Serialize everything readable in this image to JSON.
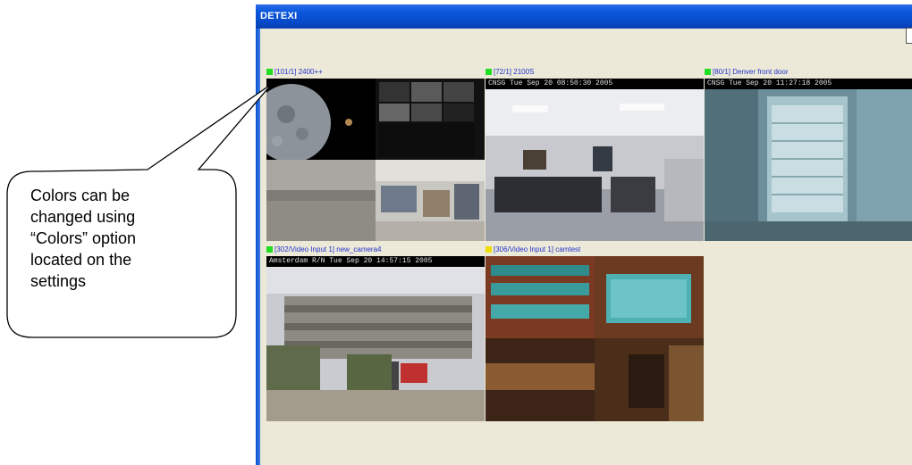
{
  "window": {
    "title": "DETEXI"
  },
  "cameras": [
    {
      "label": "[101/1] 2400++",
      "status_color": "#22dd22",
      "overlay": ""
    },
    {
      "label": "[72/1] 2100S",
      "status_color": "#22dd22",
      "overlay": "CNSG  Tue Sep 20  08:50:30  2005"
    },
    {
      "label": "[80/1] Denver front door",
      "status_color": "#22dd22",
      "overlay": "CNSG  Tue Sep 20  11:27:18  2005"
    },
    {
      "label": "[302/Video Input 1] new_camera4",
      "status_color": "#22dd22",
      "overlay": "Amsterdam R/N  Tue Sep 20  14:57:15  2005"
    },
    {
      "label": "[306/Video Input 1] camtest",
      "status_color": "#eedd00",
      "overlay": ""
    }
  ],
  "callout": {
    "text": "Colors can be\nchanged using\n“Colors” option\nlocated on the\nsettings"
  },
  "colors": {
    "titlebar": "#0a58dd",
    "window_bg": "#ece9d8",
    "label_text": "#2233cc"
  }
}
